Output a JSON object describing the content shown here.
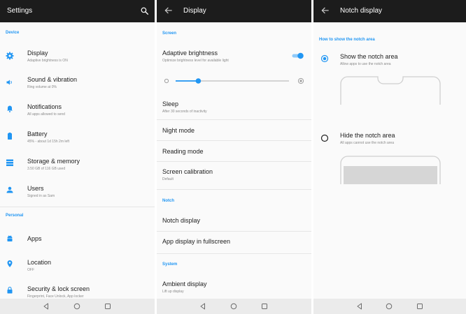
{
  "settings": {
    "title": "Settings",
    "sections": [
      "Device",
      "Personal"
    ],
    "items": [
      {
        "title": "Display",
        "subtitle": "Adaptive brightness is ON"
      },
      {
        "title": "Sound & vibration",
        "subtitle": "Ring volume at 0%"
      },
      {
        "title": "Notifications",
        "subtitle": "All apps allowed to send"
      },
      {
        "title": "Battery",
        "subtitle": "45% - about 1d 15h 2m left"
      },
      {
        "title": "Storage & memory",
        "subtitle": "3.50 GB of 116 GB used"
      },
      {
        "title": "Users",
        "subtitle": "Signed in as Sam"
      },
      {
        "title": "Apps",
        "subtitle": ""
      },
      {
        "title": "Location",
        "subtitle": "OFF"
      },
      {
        "title": "Security & lock screen",
        "subtitle": "Fingerprint, Face Unlock, App locker"
      }
    ]
  },
  "display": {
    "title": "Display",
    "sections": [
      "Screen",
      "Notch",
      "System"
    ],
    "adaptive_brightness": {
      "title": "Adaptive brightness",
      "subtitle": "Optimize brightness level for available light",
      "enabled": true
    },
    "brightness_level": 0.2,
    "items": [
      {
        "title": "Sleep",
        "subtitle": "After 30 seconds of inactivity"
      },
      {
        "title": "Night mode",
        "subtitle": ""
      },
      {
        "title": "Reading mode",
        "subtitle": ""
      },
      {
        "title": "Screen calibration",
        "subtitle": "Default"
      },
      {
        "title": "Notch display",
        "subtitle": ""
      },
      {
        "title": "App display in fullscreen",
        "subtitle": ""
      },
      {
        "title": "Ambient display",
        "subtitle": "Lift up display"
      }
    ]
  },
  "notch": {
    "title": "Notch display",
    "section": "How to show the notch area",
    "options": [
      {
        "title": "Show the notch area",
        "subtitle": "Allow apps to use the notch area",
        "selected": true
      },
      {
        "title": "Hide the notch area",
        "subtitle": "All apps cannot use the notch area",
        "selected": false
      }
    ]
  },
  "colors": {
    "accent": "#2196f3",
    "appbar": "#1c1c1c",
    "navbar": "#ebebeb"
  },
  "icons": {
    "settings": [
      "search-icon",
      "gear-icon",
      "speaker-icon",
      "bell-icon",
      "battery-icon",
      "storage-icon",
      "person-icon",
      "android-icon",
      "location-pin-icon",
      "lock-icon"
    ],
    "navigation": [
      "back-arrow-icon",
      "nav-back-icon",
      "nav-home-icon",
      "nav-recents-icon"
    ]
  }
}
